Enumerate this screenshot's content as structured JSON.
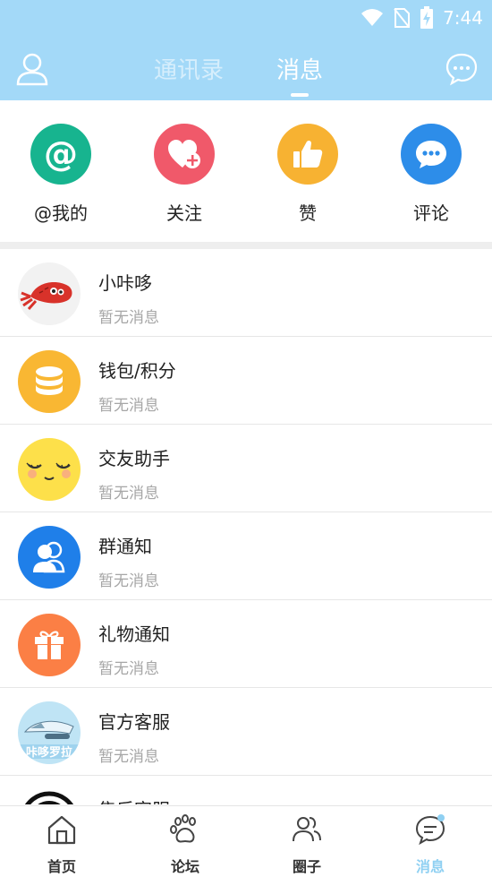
{
  "status_bar": {
    "time": "7:44"
  },
  "header": {
    "tabs": [
      {
        "label": "通讯录"
      },
      {
        "label": "消息"
      }
    ]
  },
  "quick_actions": [
    {
      "label": "@我的",
      "icon": "at-icon",
      "color": "#17b48f"
    },
    {
      "label": "关注",
      "icon": "heart-plus-icon",
      "color": "#f0596a"
    },
    {
      "label": "赞",
      "icon": "thumbs-up-icon",
      "color": "#f7b232"
    },
    {
      "label": "评论",
      "icon": "comment-icon",
      "color": "#2d8de9"
    }
  ],
  "messages": [
    {
      "title": "小咔哆",
      "subtitle": "暂无消息",
      "icon": "squid-mascot-avatar"
    },
    {
      "title": "钱包/积分",
      "subtitle": "暂无消息",
      "icon": "coins-icon"
    },
    {
      "title": "交友助手",
      "subtitle": "暂无消息",
      "icon": "smiley-face-icon"
    },
    {
      "title": "群通知",
      "subtitle": "暂无消息",
      "icon": "group-users-icon"
    },
    {
      "title": "礼物通知",
      "subtitle": "暂无消息",
      "icon": "gift-icon"
    },
    {
      "title": "官方客服",
      "subtitle": "暂无消息",
      "icon": "official-service-avatar",
      "avatar_text": "咔哆罗拉"
    },
    {
      "title": "售后客服",
      "subtitle": "",
      "icon": "after-sales-avatar"
    }
  ],
  "bottom_nav": [
    {
      "label": "首页",
      "icon": "home-icon"
    },
    {
      "label": "论坛",
      "icon": "paw-icon"
    },
    {
      "label": "圈子",
      "icon": "people-icon"
    },
    {
      "label": "消息",
      "icon": "message-icon",
      "active": true
    }
  ],
  "colors": {
    "accent": "#a3d9f8",
    "active_tab": "#8fd0f2"
  }
}
